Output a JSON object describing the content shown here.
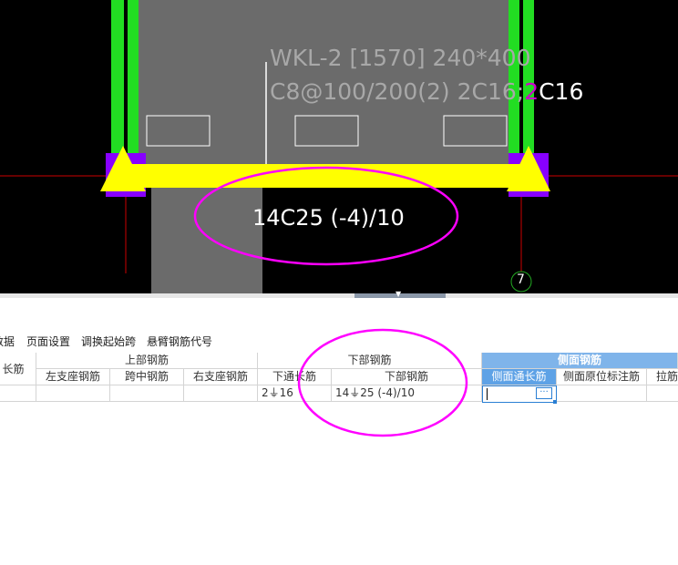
{
  "cad": {
    "beam_label_line1": "WKL-2 [1570] 240*400",
    "beam_label_line2": "C8@100/200(2) 2C16;",
    "beam_label_line2_accent": "2",
    "beam_label_line2_tail": "C16",
    "bottom_rebar_label": "14C25 (-4)/10",
    "axis_number": "7",
    "colors": {
      "column_green": "#22dd22",
      "beam_yellow": "#ffff00",
      "support_purple": "#8800ff",
      "slab_gray": "#6b6b6b",
      "axis_red": "#cc0000",
      "annotation_magenta": "#ff00ff",
      "label_gray": "#a8a8a8"
    }
  },
  "toolbar": {
    "items": [
      "数据",
      "页面设置",
      "调换起始跨",
      "悬臂钢筋代号"
    ]
  },
  "grid": {
    "group_headers": {
      "left_cut": "长筋",
      "top": "上部钢筋",
      "bottom": "下部钢筋",
      "side": "侧面钢筋"
    },
    "columns": {
      "top_left": "左支座钢筋",
      "top_mid": "跨中钢筋",
      "top_right": "右支座钢筋",
      "bottom_through": "下通长筋",
      "bottom_rebar": "下部钢筋",
      "side_through": "侧面通长筋",
      "side_original": "侧面原位标注筋",
      "tie": "拉筋"
    },
    "row": {
      "bottom_through": "2⏚16",
      "bottom_rebar": "14⏚25 (-4)/10",
      "side_through": ""
    },
    "ellipsis": "···"
  }
}
